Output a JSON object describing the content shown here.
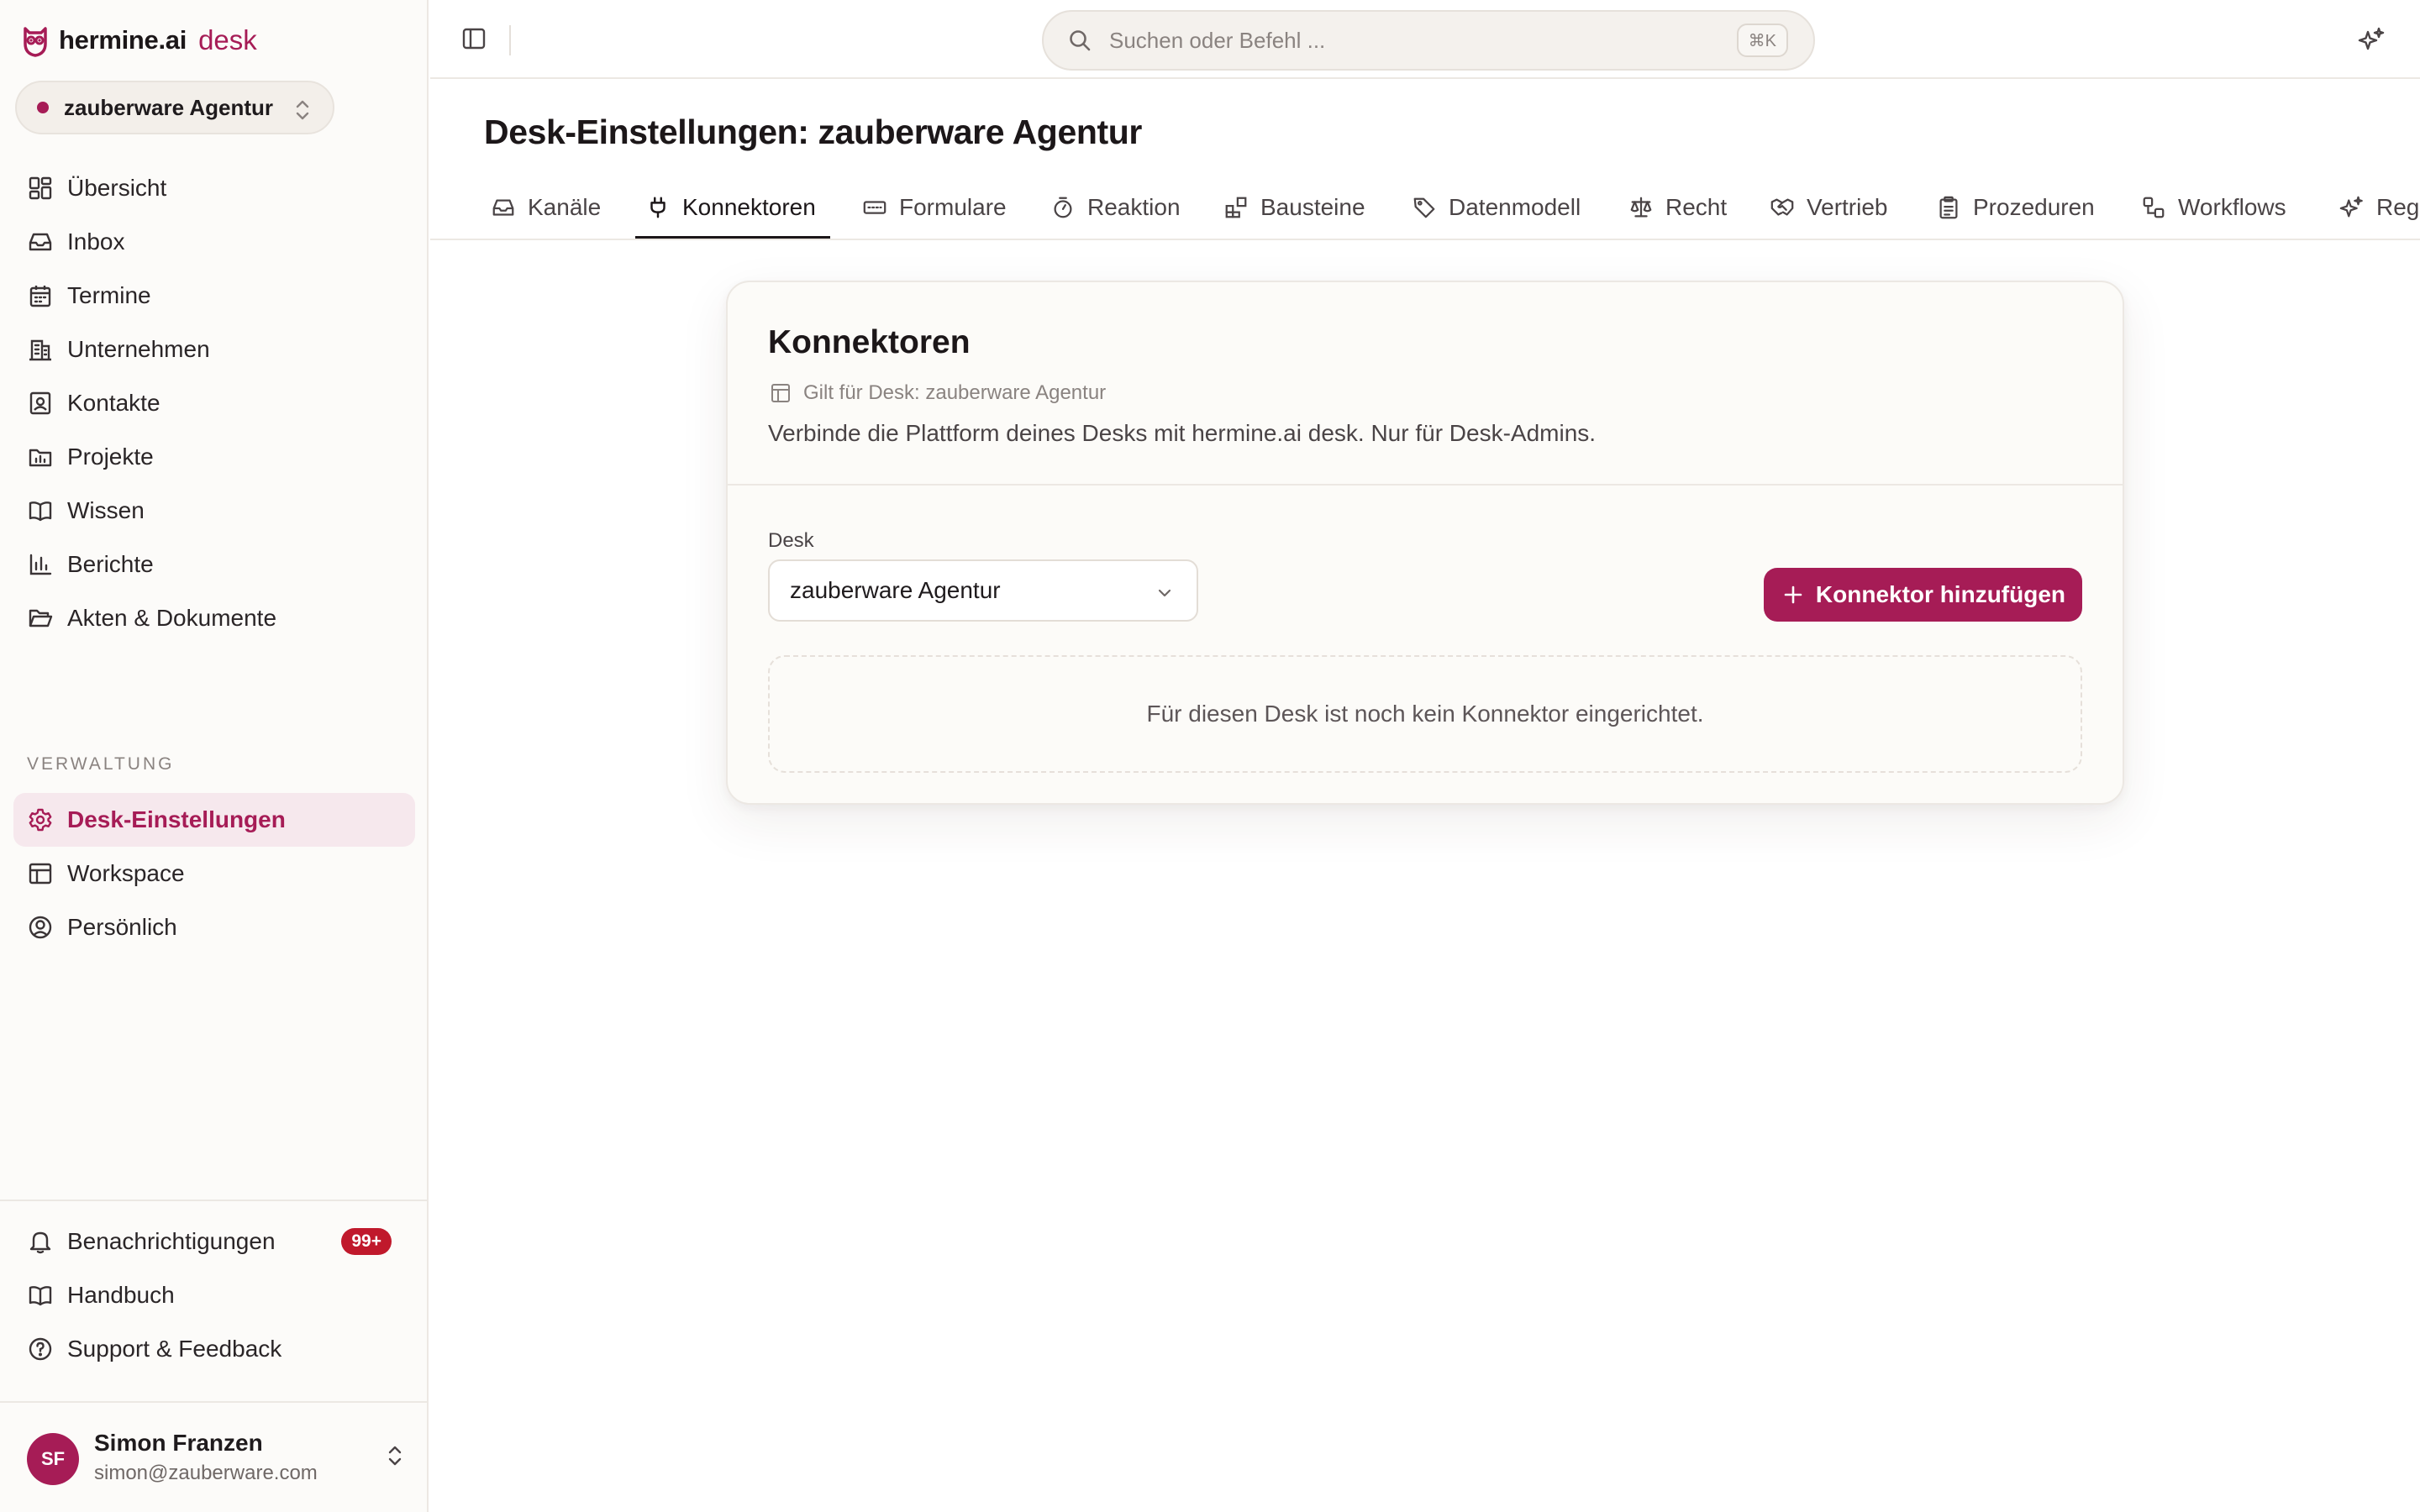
{
  "app": {
    "brand_name": "hermine.ai",
    "brand_product": "desk",
    "accent_color": "#a61c56"
  },
  "sidebar": {
    "workspace_selector": "zauberware Agentur",
    "nav_items": [
      {
        "label": "Übersicht",
        "icon": "dashboard-icon"
      },
      {
        "label": "Inbox",
        "icon": "inbox-icon"
      },
      {
        "label": "Termine",
        "icon": "calendar-icon"
      },
      {
        "label": "Unternehmen",
        "icon": "building-icon"
      },
      {
        "label": "Kontakte",
        "icon": "contact-icon"
      },
      {
        "label": "Projekte",
        "icon": "folder-chart-icon"
      },
      {
        "label": "Wissen",
        "icon": "book-icon"
      },
      {
        "label": "Berichte",
        "icon": "bar-chart-icon"
      },
      {
        "label": "Akten & Dokumente",
        "icon": "folder-open-icon"
      }
    ],
    "section_label": "VERWALTUNG",
    "admin_items": [
      {
        "label": "Desk-Einstellungen",
        "icon": "gear-icon",
        "active": true
      },
      {
        "label": "Workspace",
        "icon": "layout-icon"
      },
      {
        "label": "Persönlich",
        "icon": "user-circle-icon"
      }
    ],
    "bottom_items": [
      {
        "label": "Benachrichtigungen",
        "icon": "bell-icon",
        "badge": "99+"
      },
      {
        "label": "Handbuch",
        "icon": "book-icon"
      },
      {
        "label": "Support & Feedback",
        "icon": "help-circle-icon"
      }
    ],
    "user": {
      "initials": "SF",
      "name": "Simon Franzen",
      "email": "simon@zauberware.com"
    }
  },
  "topbar": {
    "search_placeholder": "Suchen oder Befehl ...",
    "search_shortcut": "⌘K"
  },
  "page": {
    "title": "Desk-Einstellungen: zauberware Agentur",
    "tabs": [
      {
        "label": "Kanäle",
        "icon": "inbox-icon"
      },
      {
        "label": "Konnektoren",
        "icon": "plug-icon",
        "active": true
      },
      {
        "label": "Formulare",
        "icon": "form-icon"
      },
      {
        "label": "Reaktion",
        "icon": "timer-icon"
      },
      {
        "label": "Bausteine",
        "icon": "blocks-icon"
      },
      {
        "label": "Datenmodell",
        "icon": "tag-icon"
      },
      {
        "label": "Recht",
        "icon": "scale-icon"
      },
      {
        "label": "Vertrieb",
        "icon": "handshake-icon"
      },
      {
        "label": "Prozeduren",
        "icon": "clipboard-icon"
      },
      {
        "label": "Workflows",
        "icon": "workflow-icon"
      },
      {
        "label": "Reg",
        "icon": "sparkle-icon"
      }
    ]
  },
  "card": {
    "title": "Konnektoren",
    "scope": "Gilt für Desk: zauberware Agentur",
    "description": "Verbinde die Plattform deines Desks mit hermine.ai desk. Nur für Desk-Admins.",
    "desk_label": "Desk",
    "desk_value": "zauberware Agentur",
    "add_button": "Konnektor hinzufügen",
    "empty_state": "Für diesen Desk ist noch kein Konnektor eingerichtet."
  }
}
